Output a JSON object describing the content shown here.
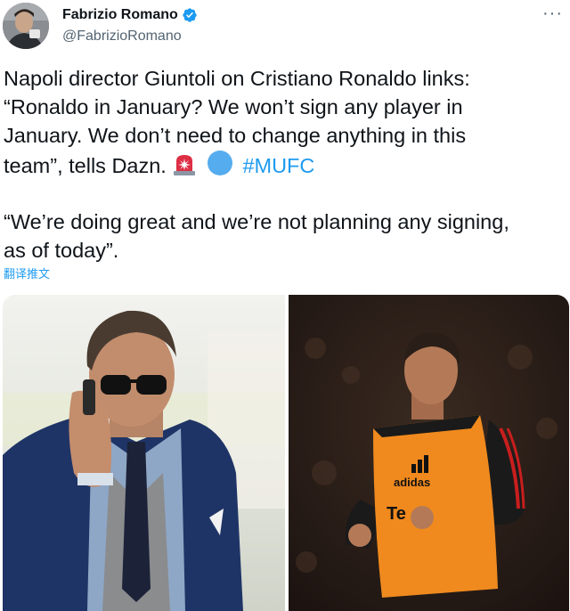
{
  "tweet": {
    "author": {
      "display_name": "Fabrizio Romano",
      "handle": "@FabrizioRomano",
      "verified": true,
      "verified_color": "#1d9bf0"
    },
    "more_icon": "more-dots-icon",
    "text_lines": [
      "Napoli director Giuntoli on Cristiano Ronaldo links:",
      "“Ronaldo in January? We won’t sign any player in",
      "January. We don’t need to change anything in this",
      "team”, tells Dazn."
    ],
    "emojis": [
      "siren-emoji",
      "blue-circle-emoji"
    ],
    "hashtag": "#MUFC",
    "quote_lines": [
      "“We’re doing great and we’re not planning any signing,",
      "as of today”."
    ],
    "translate_label": "翻译推文",
    "colors": {
      "text": "#0f1419",
      "secondary": "#536471",
      "link": "#1d9bf0"
    }
  },
  "media": {
    "left_photo": "man-in-sunglasses-on-phone-photo",
    "right_photo": {
      "description_icon": "footballer-in-orange-training-bib-photo",
      "bib_brand_text": "adidas",
      "bib_sponsor_text": "Te"
    }
  }
}
